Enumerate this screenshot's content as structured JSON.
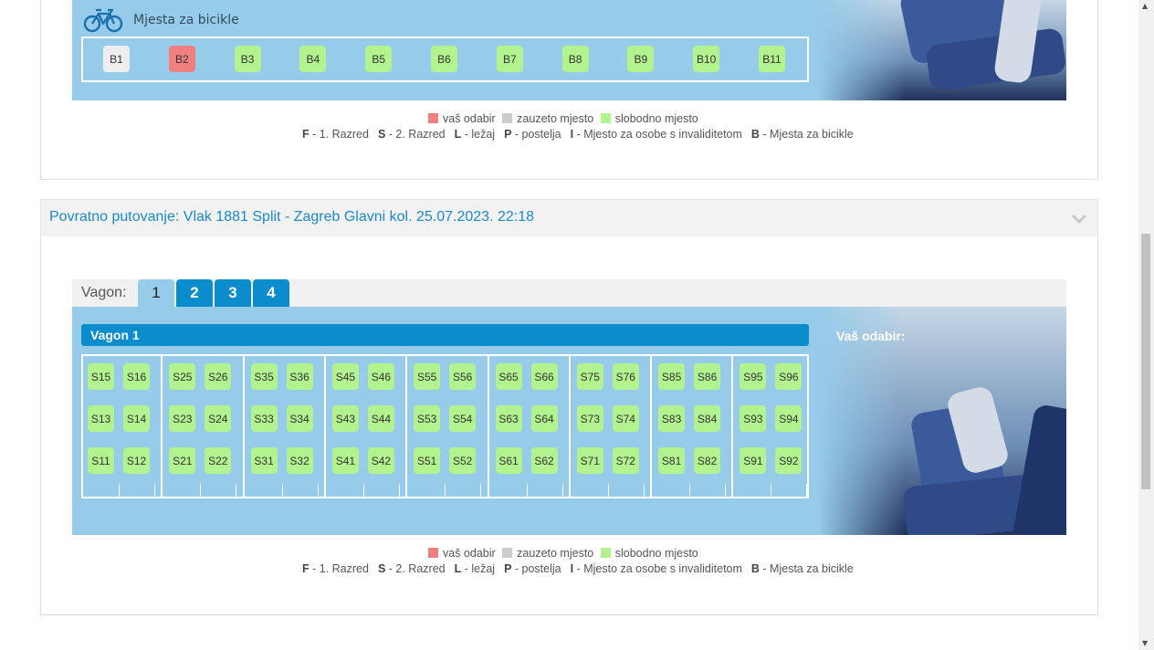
{
  "bike_section": {
    "title": "Mjesta za bicikle",
    "seats": [
      {
        "label": "B1",
        "status": "taken"
      },
      {
        "label": "B2",
        "status": "mine"
      },
      {
        "label": "B3",
        "status": "free"
      },
      {
        "label": "B4",
        "status": "free"
      },
      {
        "label": "B5",
        "status": "free"
      },
      {
        "label": "B6",
        "status": "free"
      },
      {
        "label": "B7",
        "status": "free"
      },
      {
        "label": "B8",
        "status": "free"
      },
      {
        "label": "B9",
        "status": "free"
      },
      {
        "label": "B10",
        "status": "free"
      },
      {
        "label": "B11",
        "status": "free"
      }
    ]
  },
  "legend": {
    "mine": "vaš odabir",
    "taken": "zauzeto mjesto",
    "free": "slobodno mjesto",
    "codes": [
      {
        "code": "F",
        "text": "- 1. Razred"
      },
      {
        "code": "S",
        "text": "- 2. Razred"
      },
      {
        "code": "L",
        "text": "- ležaj"
      },
      {
        "code": "P",
        "text": "- postelja"
      },
      {
        "code": "I",
        "text": "- Mjesto za osobe s invaliditetom"
      },
      {
        "code": "B",
        "text": "- Mjesta za bicikle"
      }
    ]
  },
  "return_trip": {
    "title": "Povratno putovanje: Vlak 1881 Split - Zagreb Glavni kol. 25.07.2023. 22:18",
    "vagon_label": "Vagon:",
    "tabs": [
      "1",
      "2",
      "3",
      "4"
    ],
    "active_tab": "1",
    "wagon_title": "Vagon 1",
    "your_choice_label": "Vaš odabir:",
    "compartments": [
      {
        "rows": [
          [
            "S15",
            "S16"
          ],
          [
            "S13",
            "S14"
          ],
          [
            "S11",
            "S12"
          ]
        ]
      },
      {
        "rows": [
          [
            "S25",
            "S26"
          ],
          [
            "S23",
            "S24"
          ],
          [
            "S21",
            "S22"
          ]
        ]
      },
      {
        "rows": [
          [
            "S35",
            "S36"
          ],
          [
            "S33",
            "S34"
          ],
          [
            "S31",
            "S32"
          ]
        ]
      },
      {
        "rows": [
          [
            "S45",
            "S46"
          ],
          [
            "S43",
            "S44"
          ],
          [
            "S41",
            "S42"
          ]
        ]
      },
      {
        "rows": [
          [
            "S55",
            "S56"
          ],
          [
            "S53",
            "S54"
          ],
          [
            "S51",
            "S52"
          ]
        ]
      },
      {
        "rows": [
          [
            "S65",
            "S66"
          ],
          [
            "S63",
            "S64"
          ],
          [
            "S61",
            "S62"
          ]
        ]
      },
      {
        "rows": [
          [
            "S75",
            "S76"
          ],
          [
            "S73",
            "S74"
          ],
          [
            "S71",
            "S72"
          ]
        ]
      },
      {
        "rows": [
          [
            "S85",
            "S86"
          ],
          [
            "S83",
            "S84"
          ],
          [
            "S81",
            "S82"
          ]
        ]
      },
      {
        "rows": [
          [
            "S95",
            "S96"
          ],
          [
            "S93",
            "S94"
          ],
          [
            "S91",
            "S92"
          ]
        ]
      }
    ]
  },
  "colors": {
    "free": "#b2f28f",
    "taken": "#eeeeee",
    "mine": "#f08080",
    "panel": "#96cbe9",
    "accent": "#0a8ccd",
    "title": "#1b8ac7"
  }
}
